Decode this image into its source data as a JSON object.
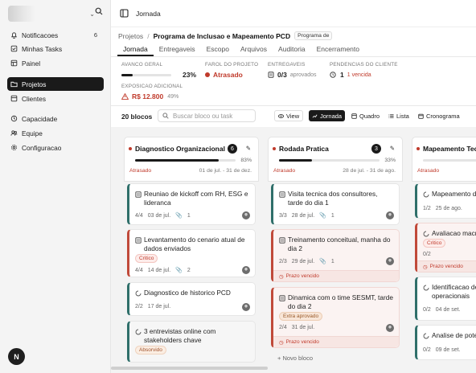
{
  "sidebar": {
    "items": [
      {
        "label": "Notificacoes",
        "count": "6",
        "icon": "bell-icon"
      },
      {
        "label": "Minhas Tasks",
        "icon": "checkbox-icon"
      },
      {
        "label": "Painel",
        "icon": "dashboard-icon"
      },
      {
        "label": "Projetos",
        "icon": "folder-icon",
        "active": true
      },
      {
        "label": "Clientes",
        "icon": "clients-icon"
      },
      {
        "label": "Capacidade",
        "icon": "capacity-icon"
      },
      {
        "label": "Equipe",
        "icon": "team-icon"
      },
      {
        "label": "Configuracao",
        "icon": "gear-icon"
      }
    ],
    "avatar_initial": "N"
  },
  "topbar": {
    "title": "Jornada"
  },
  "breadcrumb": {
    "root": "Projetos",
    "project": "Programa de Inclusao e Mapeamento PCD",
    "tag": "Programa de"
  },
  "tabs": [
    "Jornada",
    "Entregaveis",
    "Escopo",
    "Arquivos",
    "Auditoria",
    "Encerramento"
  ],
  "stats": {
    "avanco": {
      "label": "AVANCO GERAL",
      "value": "23%",
      "progress": 0.23
    },
    "farol": {
      "label": "FAROL DO PROJETO",
      "value": "Atrasado"
    },
    "entregaveis": {
      "label": "ENTREGAVEIS",
      "value": "0/3",
      "suffix": "aprovados"
    },
    "pendencias": {
      "label": "PENDENCIAS DO CLIENTE",
      "value": "1",
      "suffix": "1 vencida"
    },
    "exposicao": {
      "label": "EXPOSICAO ADICIONAL",
      "value": "R$ 12.800",
      "suffix": "49%"
    }
  },
  "toolbar": {
    "blocks_count": "20 blocos",
    "search_placeholder": "Buscar bloco ou task",
    "view_label": "View",
    "views": [
      "Jornada",
      "Quadro",
      "Lista",
      "Cronograma"
    ]
  },
  "columns": [
    {
      "title": "Diagnostico Organizacional",
      "count": "6",
      "progress_label": "83%",
      "progress": 0.83,
      "status": "Atrasado",
      "dates": "01 de jul. - 31 de dez.",
      "cards": [
        {
          "title": "Reuniao de kickoff com RH, ESG e lideranca",
          "tasks": "4/4",
          "date": "03 de jul.",
          "attachments": "1"
        },
        {
          "title": "Levantamento do cenario atual de dados enviados",
          "badge": "Critico",
          "tasks": "4/4",
          "date": "14 de jul.",
          "attachments": "2"
        },
        {
          "title": "Diagnostico de historico PCD",
          "tasks": "2/2",
          "date": "17 de jul."
        },
        {
          "title": "3 entrevistas online com stakeholders chave",
          "badge": "Absorvido"
        }
      ]
    },
    {
      "title": "Rodada Pratica",
      "count": "3",
      "progress_label": "33%",
      "progress": 0.33,
      "status": "Atrasado",
      "dates": "28 de jul. - 31 de ago.",
      "cards": [
        {
          "title": "Visita tecnica dos consultores, tarde do dia 1",
          "tasks": "3/3",
          "date": "28 de jul.",
          "attachments": "1"
        },
        {
          "title": "Treinamento conceitual, manha do dia 2",
          "tasks": "2/3",
          "date": "29 de jul.",
          "attachments": "1",
          "overdue": "Prazo vencido"
        },
        {
          "title": "Dinamica com o time SESMT, tarde do dia 2",
          "badge": "Extra aprovado",
          "tasks": "2/4",
          "date": "31 de jul.",
          "overdue": "Prazo vencido"
        }
      ],
      "new_block": "+ Novo bloco"
    },
    {
      "title": "Mapeamento Tecn",
      "status": "Atrasado",
      "cards": [
        {
          "title": "Mapeamento d",
          "tasks": "1/2",
          "date": "25 de ago."
        },
        {
          "title": "Avaliacao macr",
          "badge": "Critico",
          "tasks": "0/2",
          "date": "",
          "overdue": "Prazo vencido"
        },
        {
          "title": "Identificacao de operacionais",
          "tasks": "0/2",
          "date": "04 de set."
        },
        {
          "title": "Analise de pote",
          "tasks": "0/2",
          "date": "09 de set."
        }
      ]
    }
  ],
  "colors": {
    "accent": "#1a1a1a",
    "late": "#c03a2b",
    "teal": "#2f6f6a"
  }
}
